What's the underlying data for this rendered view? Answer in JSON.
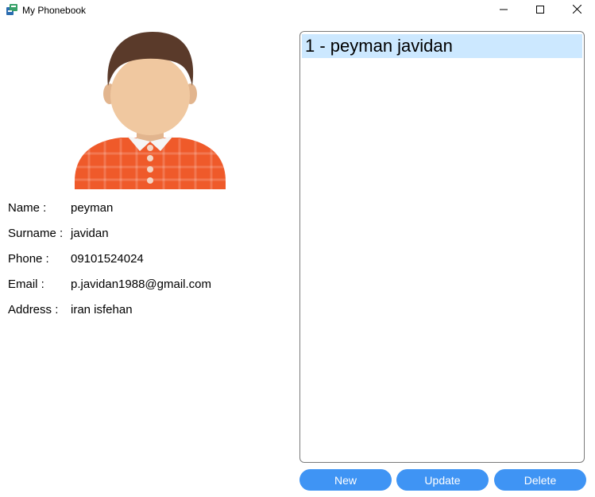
{
  "window": {
    "title": "My Phonebook",
    "icon": "phonebook-app-icon",
    "controls": [
      "minimize-icon",
      "maximize-icon",
      "close-icon"
    ]
  },
  "contact": {
    "avatar_icon": "male-avatar-icon",
    "fields": [
      {
        "label": "Name :",
        "value": "peyman"
      },
      {
        "label": "Surname :",
        "value": "javidan"
      },
      {
        "label": "Phone :",
        "value": "09101524024"
      },
      {
        "label": "Email :",
        "value": "p.javidan1988@gmail.com"
      },
      {
        "label": "Address :",
        "value": "iran isfehan"
      }
    ]
  },
  "list": {
    "items": [
      {
        "text": "1 - peyman javidan",
        "selected": true
      }
    ]
  },
  "actions": {
    "new_label": "New",
    "update_label": "Update",
    "delete_label": "Delete"
  },
  "colors": {
    "button_bg": "#3f94f4",
    "selection_bg": "#cce8ff",
    "shirt": "#ef5a2a",
    "hair": "#5a3a2a",
    "skin": "#f0c8a0"
  }
}
